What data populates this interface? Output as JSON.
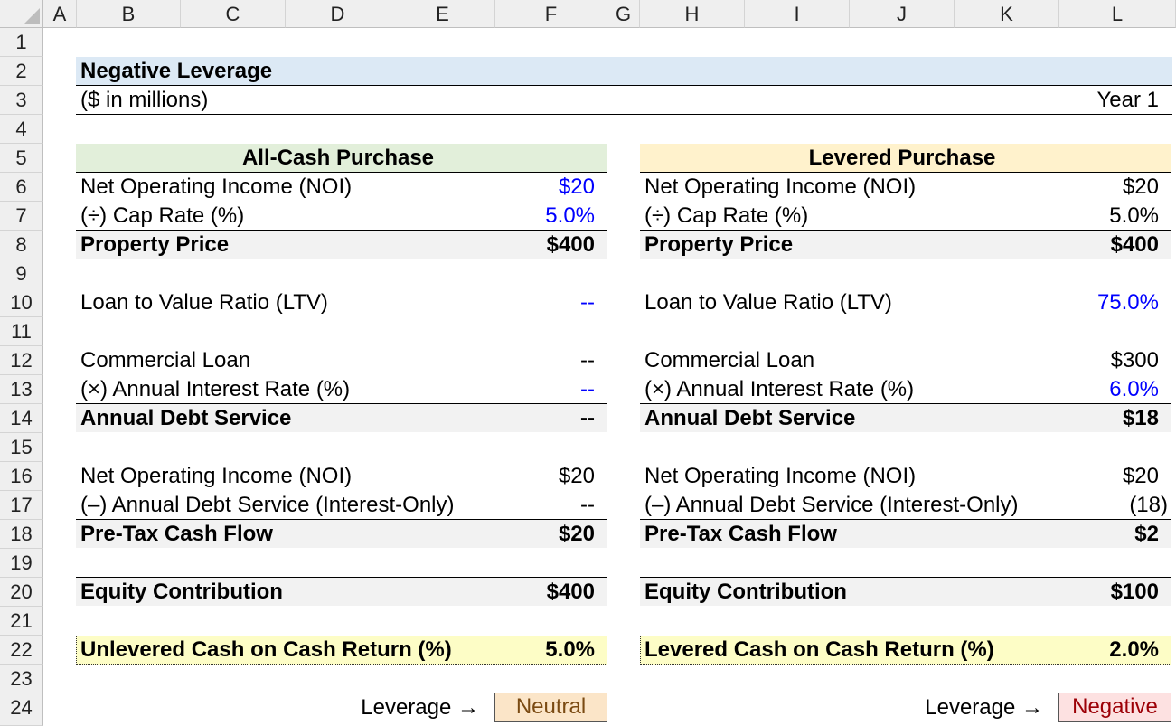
{
  "sheet": {
    "columns": [
      "A",
      "B",
      "C",
      "D",
      "E",
      "F",
      "G",
      "H",
      "I",
      "J",
      "K",
      "L"
    ],
    "rows": [
      "1",
      "2",
      "3",
      "4",
      "5",
      "6",
      "7",
      "8",
      "9",
      "10",
      "11",
      "12",
      "13",
      "14",
      "15",
      "16",
      "17",
      "18",
      "19",
      "20",
      "21",
      "22",
      "23",
      "24"
    ]
  },
  "title": "Negative Leverage",
  "units": "($ in millions)",
  "period": "Year 1",
  "colors": {
    "title_band": "#dce9f5",
    "all_cash_header": "#e2efda",
    "levered_header": "#fff2cc",
    "subtotal_band": "#f2f2f2",
    "return_box": "#fdfdc6",
    "neutral_box": "#fbe5c8",
    "negative_box": "#fde1e1",
    "input_blue": "#0000ff"
  },
  "all_cash": {
    "header": "All-Cash Purchase",
    "noi_label": "Net Operating Income (NOI)",
    "noi_value": "$20",
    "cap_rate_label": "(÷) Cap Rate (%)",
    "cap_rate_value": "5.0%",
    "price_label": "Property Price",
    "price_value": "$400",
    "ltv_label": "Loan to Value Ratio (LTV)",
    "ltv_value": "--",
    "loan_label": "Commercial Loan",
    "loan_value": "--",
    "rate_label": "(×) Annual Interest Rate (%)",
    "rate_value": "--",
    "debt_service_label": "Annual Debt Service",
    "debt_service_value": "--",
    "noi2_label": "Net Operating Income (NOI)",
    "noi2_value": "$20",
    "less_ds_label": "(–) Annual Debt Service (Interest-Only)",
    "less_ds_value": "--",
    "cash_flow_label": "Pre-Tax Cash Flow",
    "cash_flow_value": "$20",
    "equity_label": "Equity Contribution",
    "equity_value": "$400",
    "return_label": "Unlevered Cash on Cash Return (%)",
    "return_value": "5.0%",
    "leverage_label": "Leverage →",
    "leverage_value": "Neutral"
  },
  "levered": {
    "header": "Levered Purchase",
    "noi_label": "Net Operating Income (NOI)",
    "noi_value": "$20",
    "cap_rate_label": "(÷) Cap Rate (%)",
    "cap_rate_value": "5.0%",
    "price_label": "Property Price",
    "price_value": "$400",
    "ltv_label": "Loan to Value Ratio (LTV)",
    "ltv_value": "75.0%",
    "loan_label": "Commercial Loan",
    "loan_value": "$300",
    "rate_label": "(×) Annual Interest Rate (%)",
    "rate_value": "6.0%",
    "debt_service_label": "Annual Debt Service",
    "debt_service_value": "$18",
    "noi2_label": "Net Operating Income (NOI)",
    "noi2_value": "$20",
    "less_ds_label": "(–) Annual Debt Service (Interest-Only)",
    "less_ds_value": "(18)",
    "cash_flow_label": "Pre-Tax Cash Flow",
    "cash_flow_value": "$2",
    "equity_label": "Equity Contribution",
    "equity_value": "$100",
    "return_label": "Levered Cash on Cash Return (%)",
    "return_value": "2.0%",
    "leverage_label": "Leverage →",
    "leverage_value": "Negative"
  }
}
